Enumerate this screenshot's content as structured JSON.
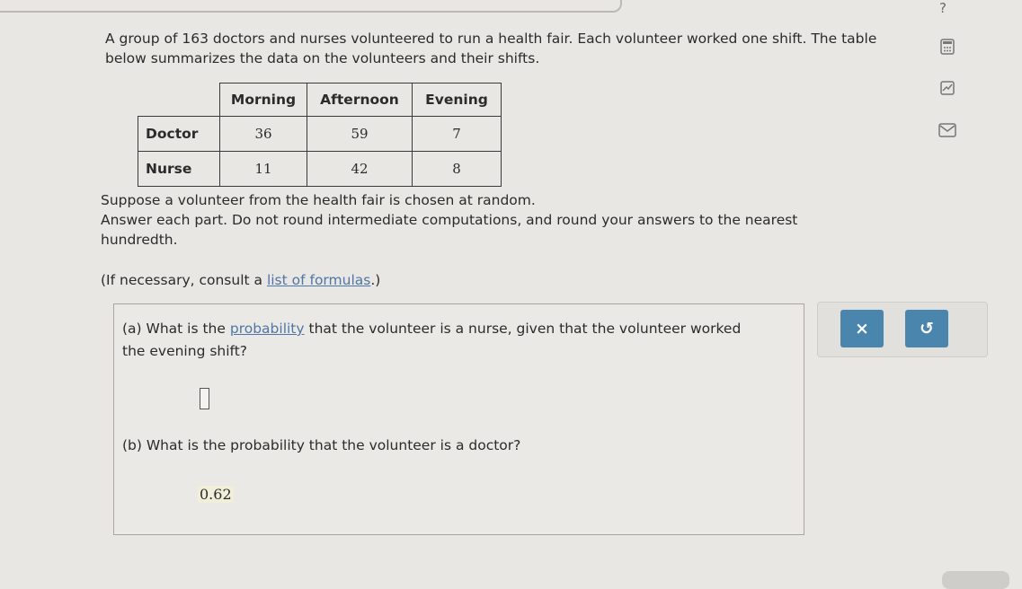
{
  "help": {
    "label": "?"
  },
  "tools": {
    "icons": [
      "calculator-icon",
      "chart-icon",
      "mail-icon"
    ]
  },
  "problem": {
    "intro": "A group of 163 doctors and nurses volunteered to run a health fair. Each volunteer worked one shift. The table below summarizes the data on the volunteers and their shifts.",
    "table": {
      "columns": [
        "Morning",
        "Afternoon",
        "Evening"
      ],
      "rows": [
        {
          "label": "Doctor",
          "values": [
            "36",
            "59",
            "7"
          ]
        },
        {
          "label": "Nurse",
          "values": [
            "11",
            "42",
            "8"
          ]
        }
      ]
    },
    "line1": "Suppose a volunteer from the health fair is chosen at random.",
    "line2": "Answer each part. Do not round intermediate computations, and round your answers to the nearest hundredth.",
    "consult_prefix": "(If necessary, consult a ",
    "consult_link": "list of formulas",
    "consult_suffix": ".)"
  },
  "parts": {
    "a_prefix": "(a) What is the ",
    "a_link": "probability",
    "a_suffix": " that the volunteer is a nurse, given that the volunteer worked the evening shift?",
    "a_answer": "",
    "b_question": "(b) What is the probability that the volunteer is a doctor?",
    "b_answer": "0.62"
  },
  "actions": {
    "clear_label": "×",
    "undo_label": "↺"
  },
  "colors": {
    "accent": "#4a85ae",
    "link": "#4f76a6"
  }
}
